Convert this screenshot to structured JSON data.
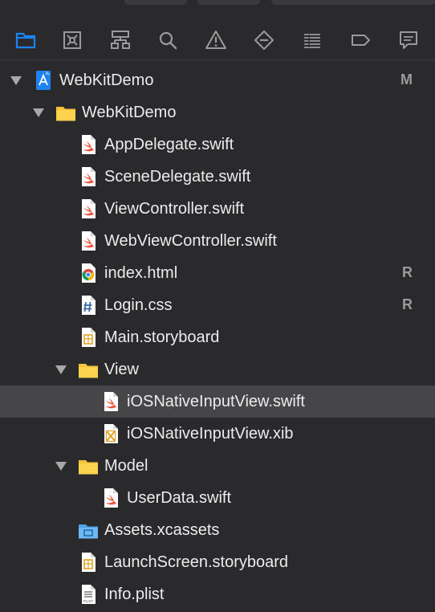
{
  "colors": {
    "background": "#2a2a2c",
    "selected_row": "#464648",
    "accent": "#1d82f2",
    "folder": "#f7c33b",
    "swift": "#f05138",
    "badge": "#9a9a9a"
  },
  "navigator_tabs": [
    {
      "name": "project-navigator",
      "icon": "folder-icon",
      "active": true
    },
    {
      "name": "source-control-navigator",
      "icon": "source-control-icon"
    },
    {
      "name": "symbol-navigator",
      "icon": "hierarchy-icon"
    },
    {
      "name": "find-navigator",
      "icon": "search-icon"
    },
    {
      "name": "issue-navigator",
      "icon": "warning-icon"
    },
    {
      "name": "test-navigator",
      "icon": "diamond-icon"
    },
    {
      "name": "debug-navigator",
      "icon": "list-icon"
    },
    {
      "name": "breakpoint-navigator",
      "icon": "breakpoint-icon"
    },
    {
      "name": "report-navigator",
      "icon": "message-icon"
    }
  ],
  "tree": [
    {
      "label": "WebKitDemo",
      "type": "project",
      "depth": 0,
      "expanded": true,
      "badge": "M"
    },
    {
      "label": "WebKitDemo",
      "type": "folder",
      "depth": 1,
      "expanded": true
    },
    {
      "label": "AppDelegate.swift",
      "type": "swift",
      "depth": 2
    },
    {
      "label": "SceneDelegate.swift",
      "type": "swift",
      "depth": 2
    },
    {
      "label": "ViewController.swift",
      "type": "swift",
      "depth": 2
    },
    {
      "label": "WebViewController.swift",
      "type": "swift",
      "depth": 2
    },
    {
      "label": "index.html",
      "type": "html",
      "depth": 2,
      "badge": "R"
    },
    {
      "label": "Login.css",
      "type": "css",
      "depth": 2,
      "badge": "R"
    },
    {
      "label": "Main.storyboard",
      "type": "storyboard",
      "depth": 2
    },
    {
      "label": "View",
      "type": "folder",
      "depth": 2,
      "expanded": true
    },
    {
      "label": "iOSNativeInputView.swift",
      "type": "swift",
      "depth": 3,
      "selected": true
    },
    {
      "label": "iOSNativeInputView.xib",
      "type": "xib",
      "depth": 3
    },
    {
      "label": "Model",
      "type": "folder",
      "depth": 2,
      "expanded": true
    },
    {
      "label": "UserData.swift",
      "type": "swift",
      "depth": 3
    },
    {
      "label": "Assets.xcassets",
      "type": "assets",
      "depth": 2
    },
    {
      "label": "LaunchScreen.storyboard",
      "type": "storyboard",
      "depth": 2
    },
    {
      "label": "Info.plist",
      "type": "plist",
      "depth": 2
    }
  ]
}
